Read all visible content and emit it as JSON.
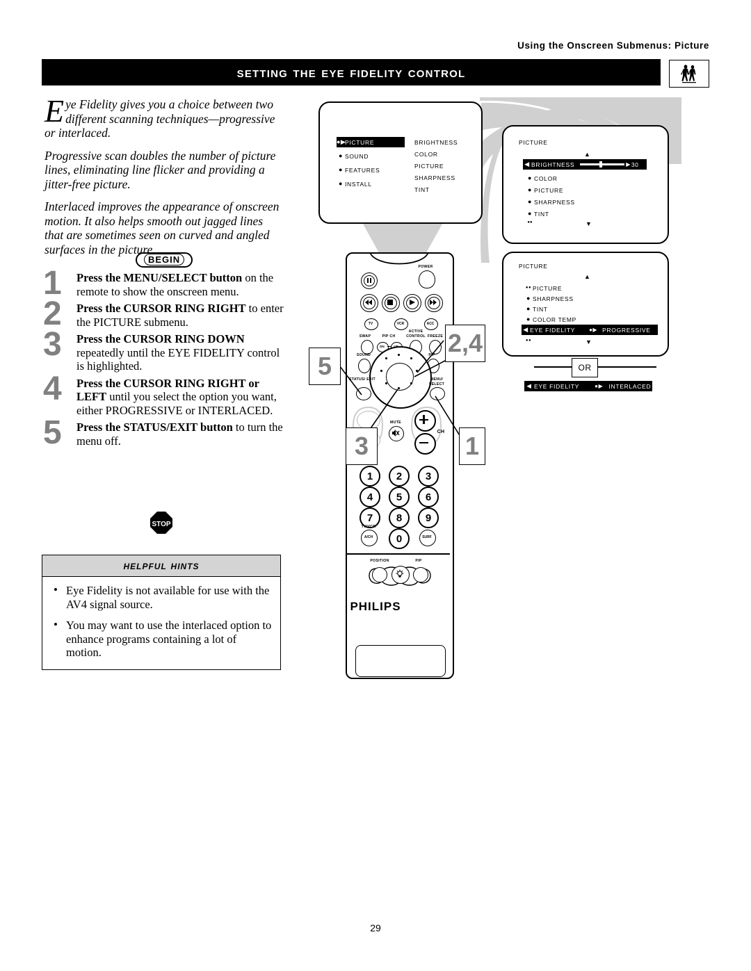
{
  "running_head": "Using the Onscreen Submenus: Picture",
  "title": "Setting the Eye Fidelity Control",
  "title_icon": "people-watching-tv-icon",
  "page_number": "29",
  "intro": {
    "dropcap": "E",
    "paragraph1": "ye Fidelity gives you a choice between two different scanning techniques—progressive or interlaced.",
    "paragraph2": "Progressive scan doubles the number of picture lines, eliminating line flicker and providing a jitter-free picture.",
    "paragraph3": "Interlaced improves the appearance of onscreen motion. It also helps smooth out jagged lines that are sometimes seen on curved and angled surfaces in the picture."
  },
  "begin_badge": "BEGIN",
  "stop_badge": "STOP",
  "steps": [
    {
      "number": "1",
      "bold": "Press the MENU/SELECT button",
      "rest": " on the remote to show the onscreen menu."
    },
    {
      "number": "2",
      "bold": "Press the CURSOR RING RIGHT",
      "rest": " to enter the PICTURE submenu."
    },
    {
      "number": "3",
      "bold": "Press the CURSOR RING DOWN",
      "rest": " repeatedly until the EYE FIDELITY control is highlighted."
    },
    {
      "number": "4",
      "bold": "Press the CURSOR RING RIGHT or LEFT",
      "rest": " until you select the option you want, either PROGRESSIVE or INTERLACED."
    },
    {
      "number": "5",
      "bold": "Press the STATUS/EXIT button",
      "rest": " to turn the menu off."
    }
  ],
  "hints": {
    "title": "Helpful Hints",
    "items": [
      "Eye Fidelity is not available for use with the AV4 signal source.",
      "You may want to use the interlaced option to enhance programs containing a lot of motion."
    ]
  },
  "tv_screens": {
    "screen1": {
      "left_menu": [
        {
          "label": "PICTURE",
          "highlighted": true
        },
        {
          "label": "SOUND",
          "highlighted": false
        },
        {
          "label": "FEATURES",
          "highlighted": false
        },
        {
          "label": "INSTALL",
          "highlighted": false
        }
      ],
      "right_menu": [
        "BRIGHTNESS",
        "COLOR",
        "PICTURE",
        "SHARPNESS",
        "TINT"
      ]
    },
    "screen2": {
      "header": "PICTURE",
      "up_arrow": "▲",
      "down_arrow": "▼",
      "items": [
        {
          "label": "BRIGHTNESS",
          "highlighted": true,
          "value": "30"
        },
        {
          "label": "COLOR",
          "highlighted": false
        },
        {
          "label": "PICTURE",
          "highlighted": false
        },
        {
          "label": "SHARPNESS",
          "highlighted": false
        },
        {
          "label": "TINT",
          "highlighted": false
        }
      ]
    },
    "screen3": {
      "header": "PICTURE",
      "up_arrow": "▲",
      "down_arrow": "▼",
      "items": [
        {
          "label": "PICTURE",
          "highlighted": false
        },
        {
          "label": "SHARPNESS",
          "highlighted": false
        },
        {
          "label": "TINT",
          "highlighted": false
        },
        {
          "label": "COLOR TEMP",
          "highlighted": false
        },
        {
          "label": "EYE FIDELITY",
          "highlighted": true,
          "value": "PROGRESSIVE"
        }
      ]
    },
    "or_label": "OR",
    "alt_bar": {
      "label": "EYE FIDELITY",
      "value": "INTERLACED"
    }
  },
  "remote": {
    "brand": "PHILIPS",
    "power_label": "POWER",
    "transport_labels": [
      "TV",
      "VCR",
      "ACC"
    ],
    "row_labels": {
      "swap": "SWAP",
      "pip_ch": "PIP CH",
      "dn": "DN",
      "up": "UP",
      "active_control": "ACTIVE CONTROL",
      "freeze": "FREEZE"
    },
    "sound_label": "SOUND",
    "pip_label": "PIP",
    "status_exit_label": "STATUS/ EXIT",
    "menu_select_label": "MENU/ SELECT",
    "mute_label": "MUTE",
    "ch_label": "CH",
    "keypad": [
      "1",
      "2",
      "3",
      "4",
      "5",
      "6",
      "7",
      "8",
      "9"
    ],
    "tv_vcr_label": "TV/VCR",
    "a_ch_label": "A/CH",
    "zero_label": "0",
    "surf_label": "SURF",
    "position_label": "POSITION",
    "pip_bottom_label": "PIP"
  },
  "callouts": [
    {
      "id": "callout-2-4",
      "text": "2,4"
    },
    {
      "id": "callout-5",
      "text": "5"
    },
    {
      "id": "callout-3",
      "text": "3"
    },
    {
      "id": "callout-1",
      "text": "1"
    }
  ],
  "colors": {
    "accent_gray": "#808080",
    "header_bg": "#000000",
    "hints_header_bg": "#d4d4d4",
    "shadow_gray": "#d0d0d0"
  }
}
